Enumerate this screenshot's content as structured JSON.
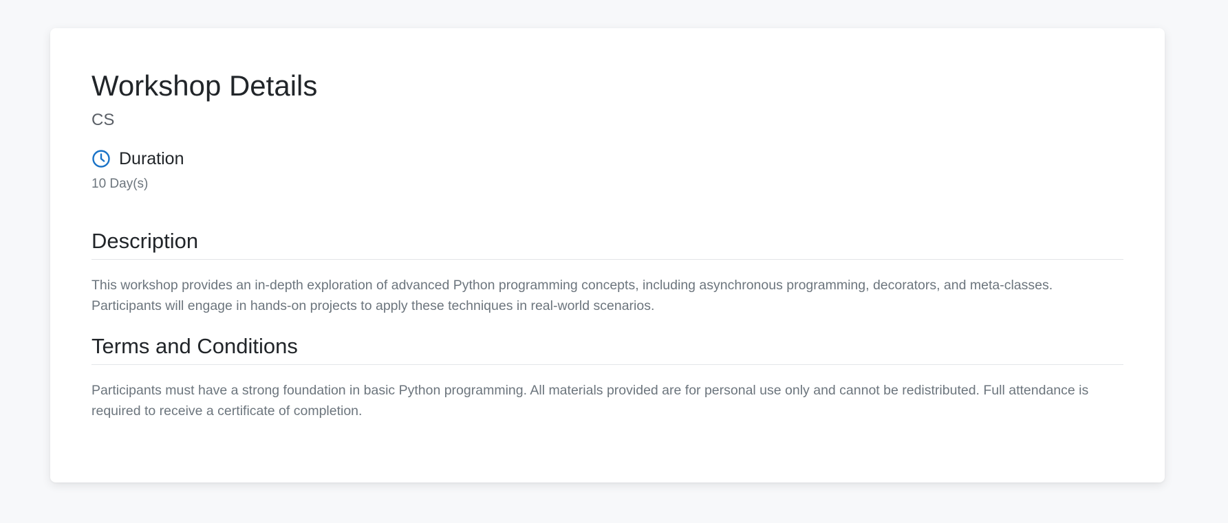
{
  "workshop": {
    "title": "Workshop Details",
    "category": "CS",
    "duration": {
      "icon": "clock-icon",
      "label": "Duration",
      "value": "10 Day(s)"
    }
  },
  "sections": {
    "description": {
      "title": "Description",
      "body": "This workshop provides an in-depth exploration of advanced Python programming concepts, including asynchronous programming, decorators, and meta-classes. Participants will engage in hands-on projects to apply these techniques in real-world scenarios."
    },
    "terms": {
      "title": "Terms and Conditions",
      "body": "Participants must have a strong foundation in basic Python programming. All materials provided are for personal use only and cannot be redistributed. Full attendance is required to receive a certificate of completion."
    }
  },
  "colors": {
    "accent": "#1a73c7",
    "background": "#f7f8fa",
    "card": "#ffffff"
  }
}
